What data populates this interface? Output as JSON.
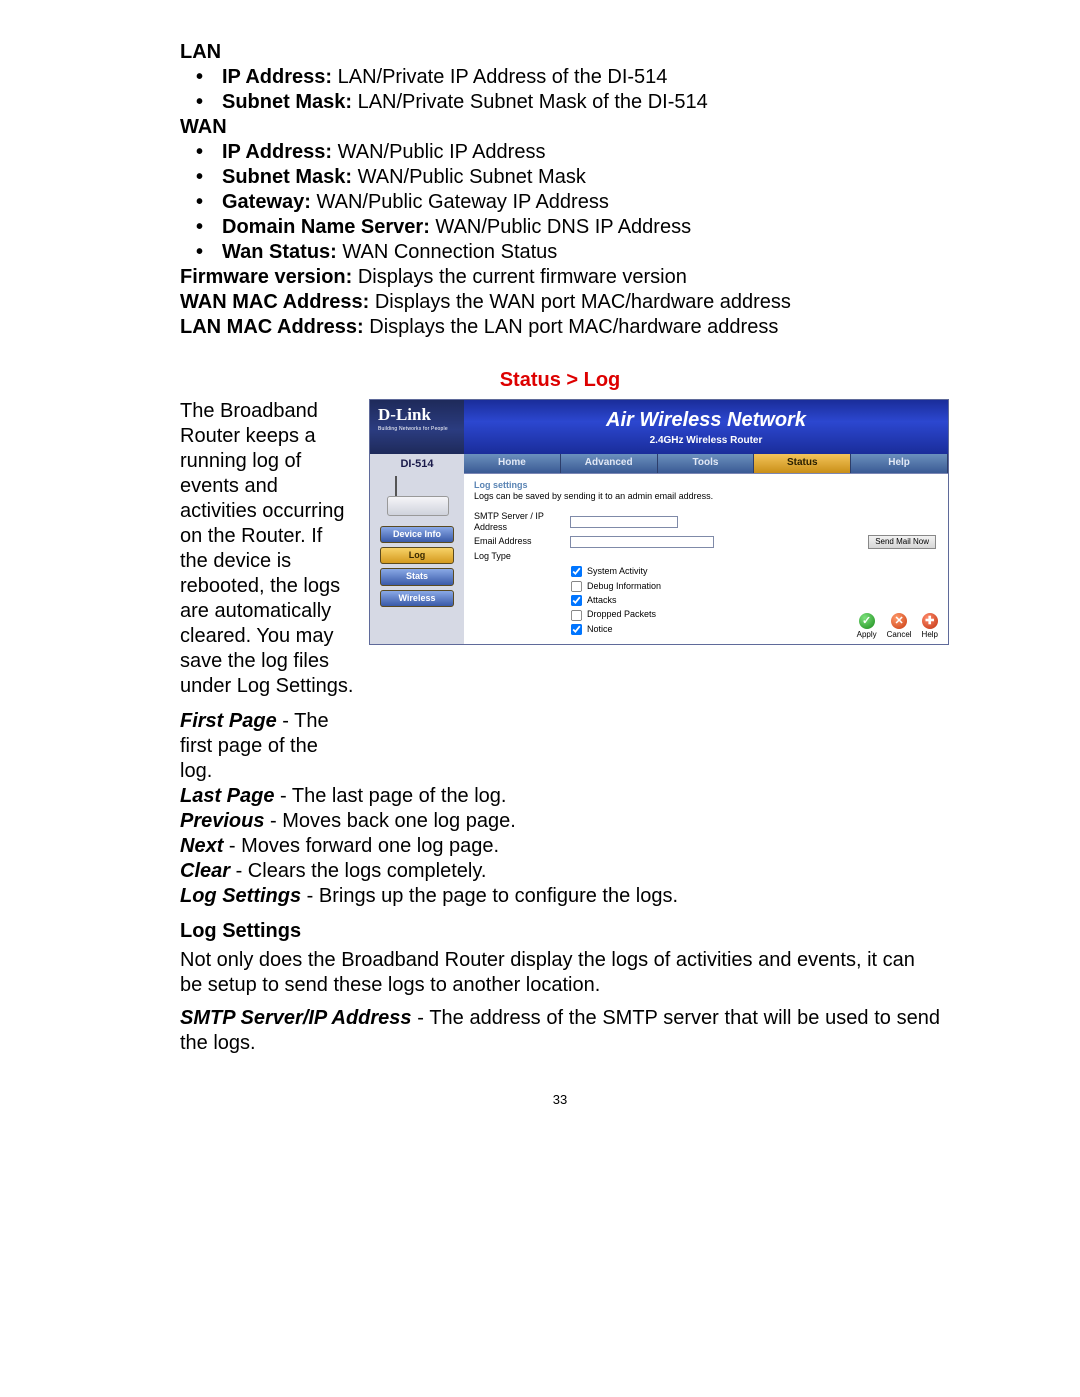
{
  "lan": {
    "heading": "LAN",
    "items": [
      {
        "label": "IP Address:",
        "desc": " LAN/Private IP Address of the DI-514"
      },
      {
        "label": "Subnet Mask:",
        "desc": " LAN/Private Subnet Mask of the DI-514"
      }
    ]
  },
  "wan": {
    "heading": "WAN",
    "items": [
      {
        "label": "IP Address:",
        "desc": " WAN/Public IP Address"
      },
      {
        "label": "Subnet Mask:",
        "desc": " WAN/Public Subnet Mask"
      },
      {
        "label": "Gateway:",
        "desc": " WAN/Public Gateway IP Address"
      },
      {
        "label": "Domain Name Server:",
        "desc": " WAN/Public DNS IP Address"
      },
      {
        "label": "Wan Status:",
        "desc": " WAN Connection Status"
      }
    ]
  },
  "misc": {
    "fw_label": "Firmware version:",
    "fw_desc": " Displays the current firmware version",
    "wanmac_label": "WAN MAC Address:",
    "wanmac_desc": " Displays the WAN port MAC/hardware address",
    "lanmac_label": "LAN MAC Address:",
    "lanmac_desc": " Displays the LAN port MAC/hardware address"
  },
  "section_title": "Status > Log",
  "intro": "The Broadband Router keeps a running log of events and activities occurring on the Router. If the device is rebooted, the logs are automatically cleared. You may save the log files under Log Settings.",
  "defs": [
    {
      "term": "First Page",
      "desc": " - The first page of the log."
    },
    {
      "term": "Last Page",
      "desc": " - The last page of the log."
    },
    {
      "term": "Previous",
      "desc": " - Moves back one log page."
    },
    {
      "term": "Next",
      "desc": " - Moves forward one log page."
    },
    {
      "term": "Clear",
      "desc": " - Clears the logs completely."
    },
    {
      "term": "Log Settings",
      "desc": " - Brings up the page to configure the logs."
    }
  ],
  "log_settings_heading": "Log Settings",
  "log_settings_para": "Not only does the Broadband Router display the logs of activities and events, it can be setup to send these logs to another location.",
  "smtp": {
    "term": "SMTP Server/IP Address",
    "desc": " - The address of the SMTP server that will be used to send the logs."
  },
  "page_number": "33",
  "router": {
    "brand": "D-Link",
    "brand_tag": "Building Networks for People",
    "title_air": "Air",
    "title_rest": " Wireless Network",
    "subtitle": "2.4GHz Wireless Router",
    "model": "DI-514",
    "side_buttons": [
      "Device Info",
      "Log",
      "Stats",
      "Wireless"
    ],
    "side_selected": "Log",
    "tabs": [
      "Home",
      "Advanced",
      "Tools",
      "Status",
      "Help"
    ],
    "tab_selected": "Status",
    "content": {
      "section": "Log settings",
      "desc": "Logs can be saved by sending it to an admin email address.",
      "field1": "SMTP Server / IP Address",
      "field2": "Email Address",
      "field3": "Log Type",
      "send_btn": "Send Mail Now",
      "checks": [
        {
          "label": "System Activity",
          "checked": true
        },
        {
          "label": "Debug Information",
          "checked": false
        },
        {
          "label": "Attacks",
          "checked": true
        },
        {
          "label": "Dropped Packets",
          "checked": false
        },
        {
          "label": "Notice",
          "checked": true
        }
      ],
      "actions": [
        {
          "label": "Apply",
          "glyph": "✓",
          "color": "c-green"
        },
        {
          "label": "Cancel",
          "glyph": "✕",
          "color": "c-red"
        },
        {
          "label": "Help",
          "glyph": "✚",
          "color": "c-red2"
        }
      ]
    }
  }
}
